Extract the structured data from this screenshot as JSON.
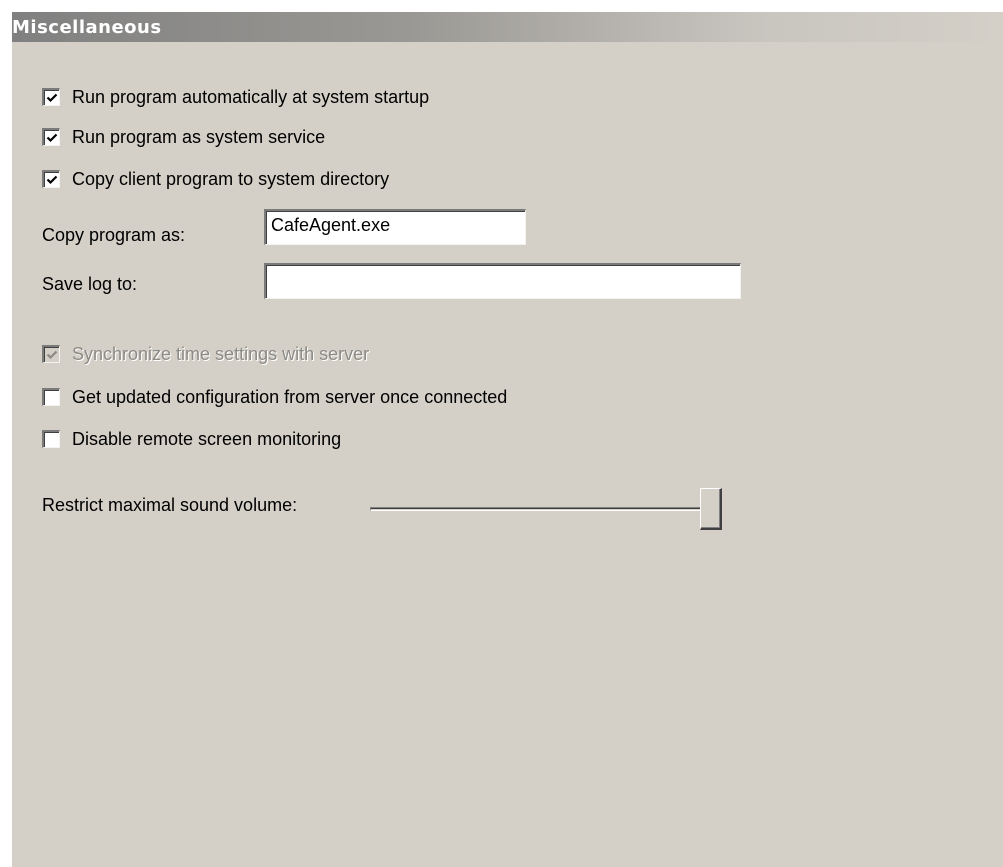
{
  "panel": {
    "title": "Miscellaneous"
  },
  "options_top": [
    {
      "label": "Run program automatically at system startup",
      "checked": true,
      "enabled": true
    },
    {
      "label": "Run program as system service",
      "checked": true,
      "enabled": true
    },
    {
      "label": "Copy client program to system directory",
      "checked": true,
      "enabled": true
    }
  ],
  "copy_program": {
    "label": "Copy program as:",
    "value": "CafeAgent.exe"
  },
  "save_log": {
    "label": "Save log to:",
    "value": ""
  },
  "options_bottom": [
    {
      "label": "Synchronize time settings with server",
      "checked": true,
      "enabled": false
    },
    {
      "label": "Get updated configuration from server once connected",
      "checked": false,
      "enabled": true
    },
    {
      "label": "Disable remote screen monitoring",
      "checked": false,
      "enabled": true
    }
  ],
  "volume": {
    "label": "Restrict maximal sound volume:",
    "level_percent": 100
  },
  "colors": {
    "panel_background": "#d4d0c8",
    "header_dark": "#808080",
    "disabled_text": "#8c8a85"
  },
  "icons": {
    "checkmark": "check-icon"
  }
}
